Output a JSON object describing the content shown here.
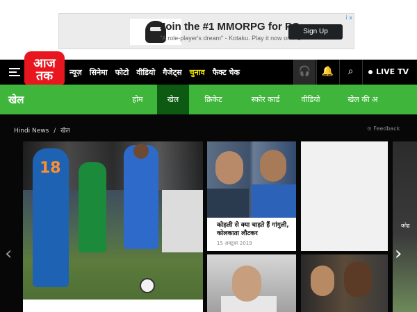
{
  "ad": {
    "title": "Join the #1 MMORPG for PC",
    "subtitle": "\"A role-player's dream\" - Kotaku. Play it now on PC",
    "button": "Sign Up",
    "badge": "i x"
  },
  "header": {
    "logo_text": "आज तक",
    "nav": [
      "न्यूज़",
      "सिनेमा",
      "फोटो",
      "वीडियो",
      "गैजेट्स",
      "चुनाव",
      "फैक्ट चेक"
    ],
    "highlight_index": 5,
    "live_label": "LIVE TV"
  },
  "section": {
    "title": "खेल",
    "tabs": [
      "होम",
      "खेल",
      "क्रिकेट",
      "स्कोर कार्ड",
      "वीडियो",
      "खेल की अ"
    ],
    "active_tab": 1
  },
  "breadcrumb": {
    "home": "Hindi News",
    "separator": "/",
    "current": "खेल"
  },
  "feedback_label": "Feedback",
  "cards": {
    "kohli": {
      "headline": "कोहली से क्या चाहते हैं गांगुली, कोलकाता लौटकर",
      "date": "15 अक्टूबर 2019"
    }
  },
  "side_peek_text": "कोह",
  "colors": {
    "brand_red": "#e8161e",
    "section_green": "#3fb63b",
    "active_tab_green": "#0d5a12",
    "highlight_yellow": "#f5e800"
  }
}
